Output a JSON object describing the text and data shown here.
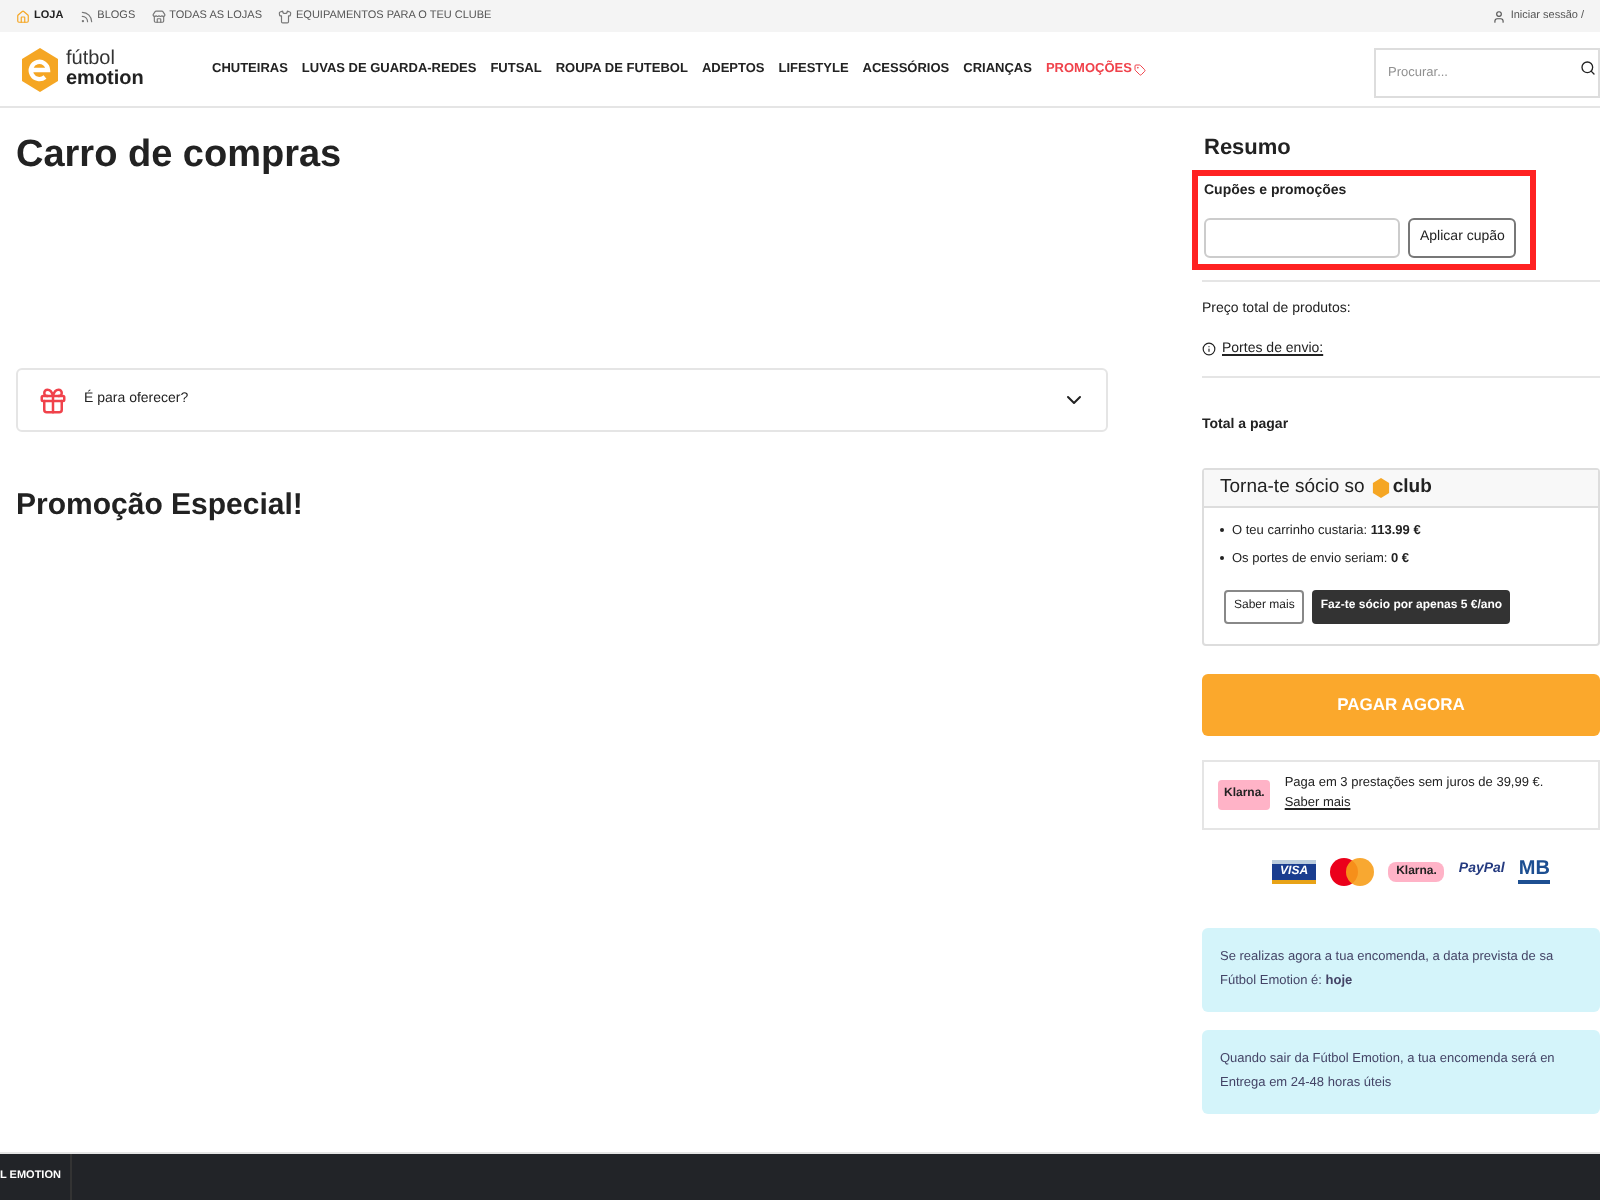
{
  "topbar": {
    "links": [
      {
        "label": "LOJA",
        "kind": "shop",
        "selected": true
      },
      {
        "label": "BLOGS",
        "kind": "rss",
        "selected": false
      },
      {
        "label": "TODAS AS LOJAS",
        "kind": "store",
        "selected": false
      },
      {
        "label": "EQUIPAMENTOS PARA O TEU CLUBE",
        "kind": "shirt",
        "selected": false
      }
    ],
    "login": "Iniciar sessão /"
  },
  "header": {
    "logo": {
      "line1": "fútbol",
      "line2": "emotion"
    },
    "nav": [
      {
        "label": "CHUTEIRAS",
        "kind": "normal"
      },
      {
        "label": "LUVAS DE GUARDA-REDES",
        "kind": "normal"
      },
      {
        "label": "FUTSAL",
        "kind": "normal"
      },
      {
        "label": "ROUPA DE FUTEBOL",
        "kind": "normal"
      },
      {
        "label": "ADEPTOS",
        "kind": "normal"
      },
      {
        "label": "LIFESTYLE",
        "kind": "normal"
      },
      {
        "label": "ACESSÓRIOS",
        "kind": "normal"
      },
      {
        "label": "CRIANÇAS",
        "kind": "normal"
      },
      {
        "label": "PROMOÇÕES",
        "kind": "promo"
      }
    ],
    "search": {
      "placeholder": "Procurar..."
    }
  },
  "cart": {
    "title": "Carro de compras",
    "gift": {
      "label": "É para oferecer?",
      "expanded": false
    },
    "promo_title": "Promoção Especial!"
  },
  "summary": {
    "title": "Resumo",
    "coupon": {
      "title": "Cupões e promoções",
      "button": "Aplicar cupão"
    },
    "product_total": "Preço total de produtos:",
    "shipping": "Portes de envio:",
    "total": "Total a pagar",
    "club": {
      "title": "Torna-te sócio so",
      "brand": "club",
      "bullets": [
        "O teu carrinho custaria: **113.99 €**",
        "Os portes de envio seriam: **0 €**"
      ],
      "more": "Saber mais",
      "join": "Faz-te sócio por apenas 5 €/ano"
    },
    "pay_button": "PAGAR AGORA",
    "klarna": {
      "badge": "Klarna.",
      "text": "Paga em 3 prestações sem juros de 39,99 €.",
      "link": "Saber mais"
    },
    "payment_logos": [
      {
        "kind": "visa",
        "label": "VISA"
      },
      {
        "kind": "mastercard"
      },
      {
        "kind": "klarna",
        "label": "Klarna."
      },
      {
        "kind": "paypal",
        "label": "PayPal"
      },
      {
        "kind": "mb",
        "label": "MB"
      }
    ],
    "notices": [
      "Se realizas agora a tua encomenda, a data prevista de sa\nFútbol Emotion é: **hoje**",
      "Quando sair da Fútbol Emotion, a tua encomenda será en\nEntrega em 24-48 horas úteis"
    ]
  },
  "footer": {
    "text": "L EMOTION"
  }
}
